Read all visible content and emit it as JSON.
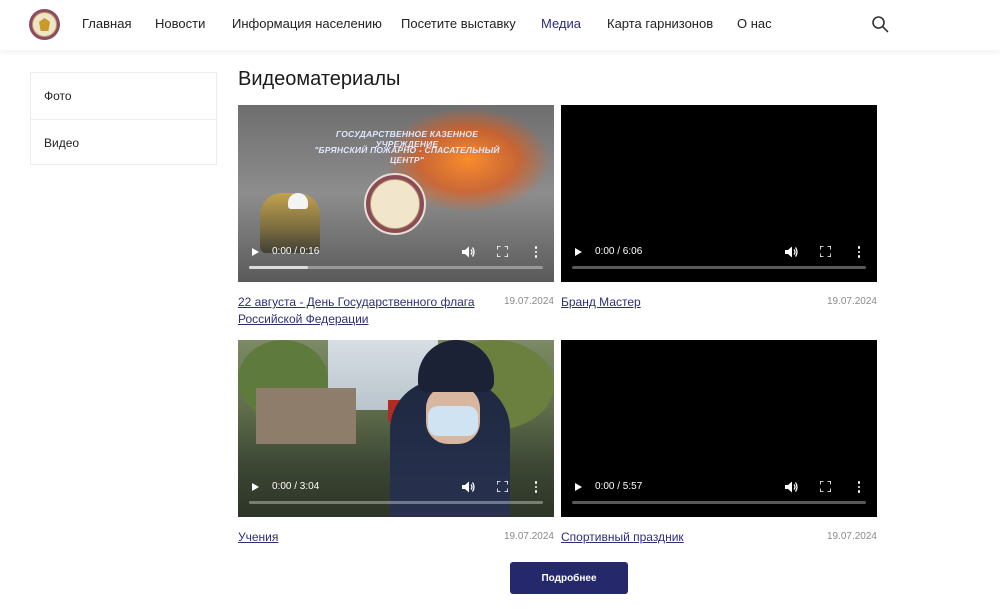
{
  "header": {
    "nav": [
      {
        "label": "Главная",
        "active": false
      },
      {
        "label": "Новости",
        "active": false
      },
      {
        "label": "Информация населению",
        "active": false
      },
      {
        "label": "Посетите выставку",
        "active": false
      },
      {
        "label": "Медиа",
        "active": true
      },
      {
        "label": "Карта гарнизонов",
        "active": false
      },
      {
        "label": "О нас",
        "active": false
      }
    ],
    "search_icon": "search-icon",
    "logo_icon": "emblem-logo"
  },
  "sidebar": {
    "items": [
      {
        "label": "Фото"
      },
      {
        "label": "Видео"
      }
    ]
  },
  "main": {
    "title": "Видеоматериалы",
    "videos": [
      {
        "title": "22 августа - День Государственного флага Российской Федерации",
        "date": "19.07.2024",
        "time": "0:00 / 0:16",
        "progress_fraction": 0.2,
        "banner_line1": "ГОСУДАРСТВЕННОЕ КАЗЕННОЕ УЧРЕЖДЕНИЕ",
        "banner_line2": "\"БРЯНСКИЙ ПОЖАРНО - СПАСАТЕЛЬНЫЙ ЦЕНТР\""
      },
      {
        "title": "Бранд Мастер",
        "date": "19.07.2024",
        "time": "0:00 / 6:06",
        "progress_fraction": 0.0
      },
      {
        "title": "Учения",
        "date": "19.07.2024",
        "time": "0:00 / 3:04",
        "progress_fraction": 0.0
      },
      {
        "title": "Спортивный праздник",
        "date": "19.07.2024",
        "time": "0:00 / 5:57",
        "progress_fraction": 0.0
      }
    ],
    "more_button": "Подробнее"
  },
  "colors": {
    "accent": "#2b2f7a",
    "button": "#25286a",
    "date_gray": "#8a8a8a"
  }
}
